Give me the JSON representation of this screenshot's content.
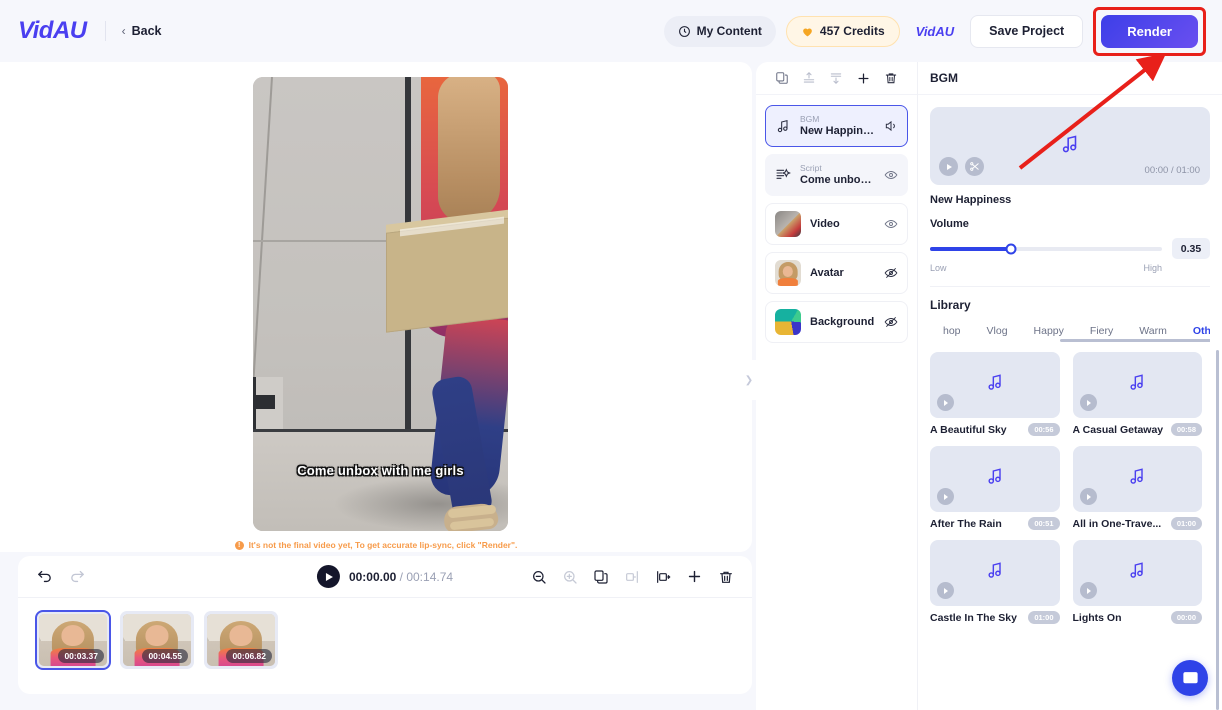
{
  "topbar": {
    "logo": "VidAU",
    "back_label": "Back",
    "back_chevron": "‹",
    "my_content": "My Content",
    "credits": "457 Credits",
    "mini_logo": "VidAU",
    "save_project": "Save Project",
    "render": "Render",
    "render_highlight_color": "#e8201a",
    "render_button_color": "#3d3fe8",
    "clock_icon": "clock-icon",
    "heart_icon": "heart-icon"
  },
  "stage": {
    "caption": "Come unbox with me girls",
    "warning": "It's not the final video yet, To get accurate lip-sync, click \"Render\".",
    "warning_color": "#f79b4a",
    "warning_icon": "info-icon"
  },
  "timeline": {
    "undo_icon": "undo-icon",
    "redo_icon": "redo-icon",
    "play_icon": "play-icon",
    "current_time": "00:00.00",
    "separator": " / ",
    "total_time": "00:14.74",
    "tools": [
      {
        "name": "zoom-out-icon",
        "disabled": false
      },
      {
        "name": "zoom-in-icon",
        "disabled": true
      },
      {
        "name": "duplicate-icon",
        "disabled": false
      },
      {
        "name": "split-left-icon",
        "disabled": true
      },
      {
        "name": "split-right-icon",
        "disabled": false
      },
      {
        "name": "add-icon",
        "disabled": false
      },
      {
        "name": "delete-icon",
        "disabled": false
      }
    ],
    "clips": [
      {
        "time": "00:03.37",
        "selected": true
      },
      {
        "time": "00:04.55",
        "selected": false
      },
      {
        "time": "00:06.82",
        "selected": false
      }
    ]
  },
  "collapse_handle": {
    "icon": "chevron-right-icon",
    "glyph": "❯"
  },
  "layers": {
    "toolbar": [
      {
        "name": "copy-icon"
      },
      {
        "name": "bring-forward-icon"
      },
      {
        "name": "send-backward-icon"
      },
      {
        "name": "add-layer-icon"
      },
      {
        "name": "delete-layer-icon"
      }
    ],
    "items": [
      {
        "id": "bgm",
        "sub": "BGM",
        "name": "New Happiness",
        "icon": "music-note-icon",
        "action_icon": "volume-icon",
        "active": true,
        "dim": false,
        "thumb": null
      },
      {
        "id": "script",
        "sub": "Script",
        "name": "Come unbox ...",
        "icon": "script-icon",
        "action_icon": "eye-icon",
        "active": false,
        "dim": true,
        "thumb": null
      },
      {
        "id": "video",
        "sub": "",
        "name": "Video",
        "icon": null,
        "action_icon": "eye-icon",
        "active": false,
        "dim": false,
        "thumb": "video"
      },
      {
        "id": "avatar",
        "sub": "",
        "name": "Avatar",
        "icon": null,
        "action_icon": "eye-off-icon",
        "active": false,
        "dim": false,
        "thumb": "avatar"
      },
      {
        "id": "background",
        "sub": "",
        "name": "Background",
        "icon": null,
        "action_icon": "eye-off-icon",
        "active": false,
        "dim": false,
        "thumb": "background"
      }
    ]
  },
  "bgm": {
    "header": "BGM",
    "note_icon": "music-note-icon",
    "play_icon": "play-icon",
    "cut_icon": "scissors-icon",
    "time": "00:00 / 01:00",
    "track_name": "New Happiness",
    "volume_label": "Volume",
    "volume_value": "0.35",
    "volume_percent": 35,
    "volume_low": "Low",
    "volume_high": "High",
    "accent": "#2f43e8"
  },
  "library": {
    "title": "Library",
    "tabs": [
      {
        "label": "hop",
        "active": false
      },
      {
        "label": "Vlog",
        "active": false
      },
      {
        "label": "Happy",
        "active": false
      },
      {
        "label": "Fiery",
        "active": false
      },
      {
        "label": "Warm",
        "active": false
      },
      {
        "label": "Other",
        "active": true
      }
    ],
    "songs": [
      {
        "name": "A Beautiful Sky",
        "duration": "00:56"
      },
      {
        "name": "A Casual Getaway",
        "duration": "00:58"
      },
      {
        "name": "After The Rain",
        "duration": "00:51"
      },
      {
        "name": "All in One-Trave...",
        "duration": "01:00"
      },
      {
        "name": "Castle In The Sky",
        "duration": "01:00"
      },
      {
        "name": "Lights On",
        "duration": "00:00"
      }
    ]
  },
  "chat": {
    "icon": "chat-bubble-icon"
  }
}
